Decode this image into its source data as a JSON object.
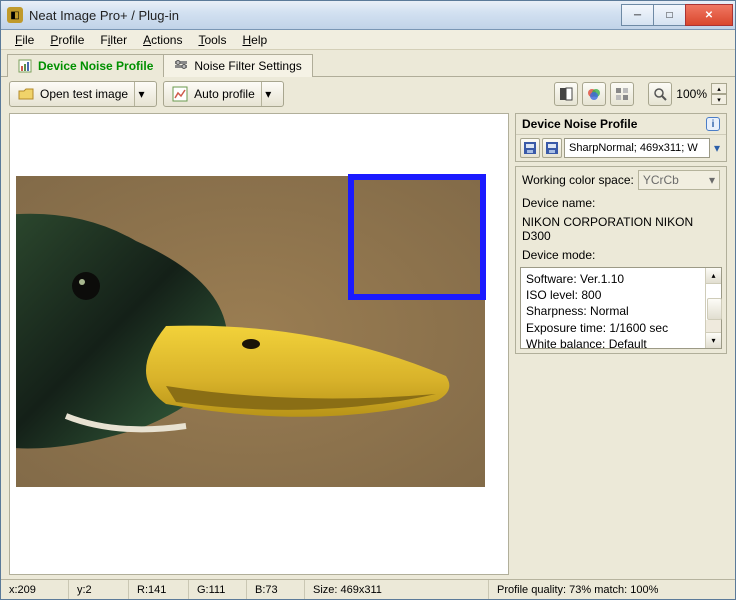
{
  "title": "Neat Image Pro+ / Plug-in",
  "menu": {
    "file": "File",
    "profile": "Profile",
    "filter": "Filter",
    "actions": "Actions",
    "tools": "Tools",
    "help": "Help"
  },
  "tabs": {
    "profile": "Device Noise Profile",
    "filter": "Noise Filter Settings"
  },
  "toolbar": {
    "open": "Open test image",
    "auto": "Auto profile",
    "zoom": "100%"
  },
  "side": {
    "heading": "Device Noise Profile",
    "filename": "SharpNormal; 469x311; W",
    "wcs_label": "Working color space:",
    "wcs_value": "YCrCb",
    "devname_label": "Device name:",
    "devname_value": "NIKON CORPORATION NIKON D300",
    "devmode_label": "Device mode:",
    "meta": {
      "software": "Software: Ver.1.10",
      "iso": "ISO level: 800",
      "sharpness": "Sharpness: Normal",
      "exposure": "Exposure time: 1/1600 sec",
      "wb": "White balance: Default"
    }
  },
  "status": {
    "x": "x:209",
    "y": "y:2",
    "r": "R:141",
    "g": "G:111",
    "b": "B:73",
    "size": "Size: 469x311",
    "quality": "Profile quality: 73%  match: 100%"
  }
}
